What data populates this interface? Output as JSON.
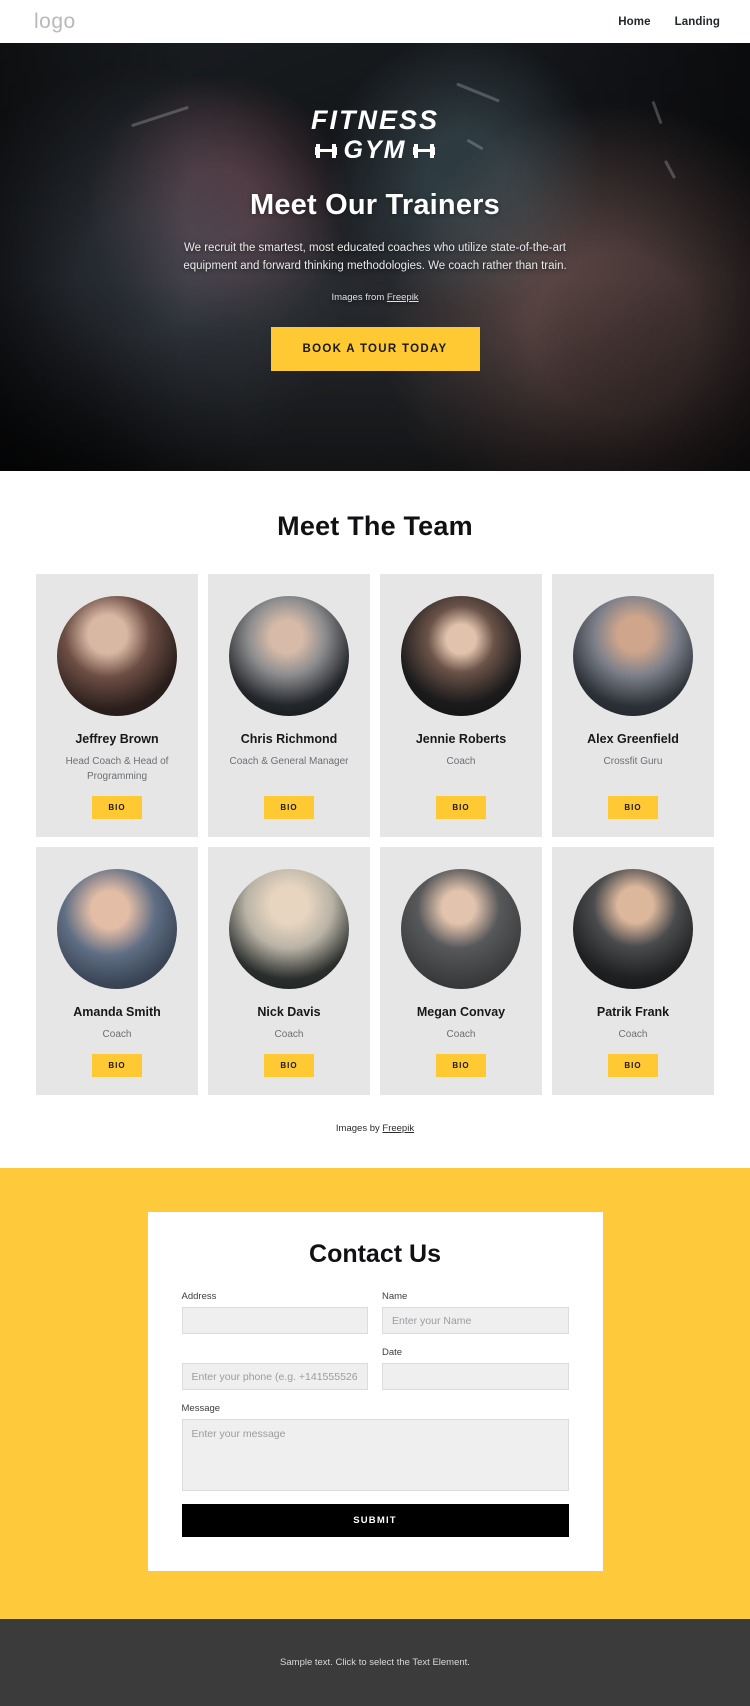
{
  "header": {
    "logo": "logo",
    "nav": [
      {
        "label": "Home"
      },
      {
        "label": "Landing"
      }
    ]
  },
  "hero": {
    "brand_top": "FITNESS",
    "brand_bottom": "GYM",
    "title": "Meet Our Trainers",
    "subtitle": "We recruit the smartest, most educated coaches who utilize state-of-the-art equipment and forward thinking methodologies. We coach rather than train.",
    "credit_prefix": "Images from ",
    "credit_link": "Freepik",
    "cta_label": "BOOK A TOUR TODAY",
    "cta_color": "#ffc933"
  },
  "team": {
    "title": "Meet The Team",
    "bio_label": "BIO",
    "credit_prefix": "Images by ",
    "credit_link": "Freepik",
    "members": [
      {
        "name": "Jeffrey Brown",
        "role": "Head Coach & Head of Programming",
        "bio": "BIO"
      },
      {
        "name": "Chris Richmond",
        "role": "Coach & General Manager",
        "bio": "BIO"
      },
      {
        "name": "Jennie Roberts",
        "role": "Coach",
        "bio": "BIO"
      },
      {
        "name": "Alex Greenfield",
        "role": "Crossfit Guru",
        "bio": "BIO"
      },
      {
        "name": "Amanda Smith",
        "role": "Coach",
        "bio": "BIO"
      },
      {
        "name": "Nick Davis",
        "role": "Coach",
        "bio": "BIO"
      },
      {
        "name": "Megan Convay",
        "role": "Coach",
        "bio": "BIO"
      },
      {
        "name": "Patrik Frank",
        "role": "Coach",
        "bio": "BIO"
      }
    ]
  },
  "contact": {
    "title": "Contact Us",
    "background_color": "#ffc93c",
    "fields": {
      "address": {
        "label": "Address",
        "value": "",
        "placeholder": ""
      },
      "name": {
        "label": "Name",
        "value": "",
        "placeholder": "Enter your Name"
      },
      "phone": {
        "label": "",
        "value": "",
        "placeholder": "Enter your phone (e.g. +141555526"
      },
      "date": {
        "label": "Date",
        "value": "",
        "placeholder": ""
      },
      "message": {
        "label": "Message",
        "value": "",
        "placeholder": "Enter your message"
      }
    },
    "submit_label": "SUBMIT"
  },
  "footer": {
    "text": "Sample text. Click to select the Text Element."
  }
}
